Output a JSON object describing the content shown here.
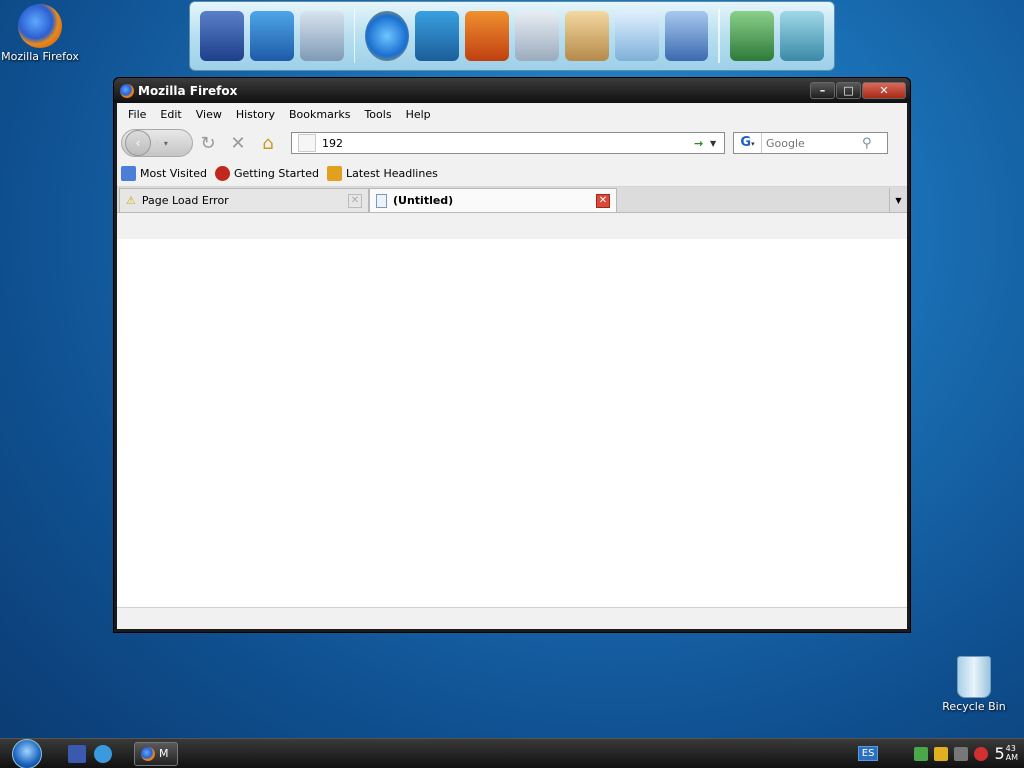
{
  "desktop": {
    "icons": [
      {
        "label": "Mozilla Firefox"
      },
      {
        "label": "Recycle Bin"
      }
    ]
  },
  "window": {
    "title": "Mozilla Firefox",
    "controls": {
      "minimize": "–",
      "maximize": "□",
      "close": "✕"
    }
  },
  "menubar": [
    "File",
    "Edit",
    "View",
    "History",
    "Bookmarks",
    "Tools",
    "Help"
  ],
  "navbar": {
    "url_value": "192",
    "search_placeholder": "Google",
    "search_engine": "G"
  },
  "bookmarks": [
    {
      "label": "Most Visited",
      "icon": "bookmark-folder-icon",
      "color": "#4a7ed8"
    },
    {
      "label": "Getting Started",
      "icon": "firefox-icon",
      "color": "#c0281e"
    },
    {
      "label": "Latest Headlines",
      "icon": "rss-icon",
      "color": "#e2a020"
    }
  ],
  "tabs": [
    {
      "label": "Page Load Error",
      "active": false
    },
    {
      "label": "(Untitled)",
      "active": true
    }
  ],
  "taskbar": {
    "task_label": "M",
    "language": "ES",
    "clock_hour": "5",
    "clock_minutes": "43",
    "clock_ampm": "AM"
  }
}
